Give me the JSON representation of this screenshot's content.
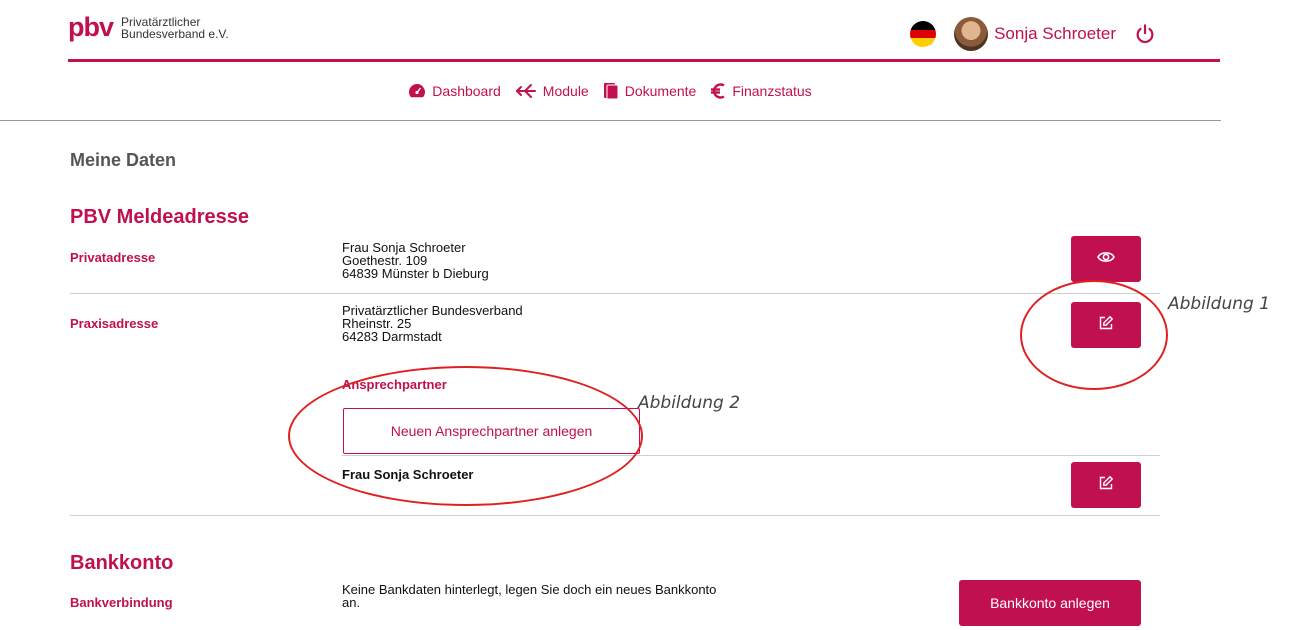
{
  "header": {
    "logo_mark": "pbv",
    "logo_line1": "Privatärztlicher",
    "logo_line2": "Bundesverband e.V.",
    "user_name": "Sonja Schroeter",
    "flag_colors": [
      "#000000",
      "#dd0000",
      "#ffce00"
    ],
    "icons": [
      "flag-de-icon",
      "avatar",
      "power-icon"
    ]
  },
  "nav": {
    "items": [
      {
        "label": "Dashboard",
        "icon": "dashboard-icon"
      },
      {
        "label": "Module",
        "icon": "module-icon"
      },
      {
        "label": "Dokumente",
        "icon": "documents-icon"
      },
      {
        "label": "Finanzstatus",
        "icon": "euro-icon"
      }
    ]
  },
  "main": {
    "title": "Meine Daten",
    "meldeadresse": {
      "title": "PBV Meldeadresse",
      "privat": {
        "label": "Privatadresse",
        "lines": [
          "Frau Sonja Schroeter",
          "Goethestr. 109",
          "64839 Münster b Dieburg"
        ]
      },
      "praxis": {
        "label": "Praxisadresse",
        "lines": [
          "Privatärztlicher Bundesverband",
          "Rheinstr. 25",
          "64283 Darmstadt"
        ]
      },
      "contacts": {
        "heading": "Ansprechpartner",
        "new_button": "Neuen Ansprechpartner anlegen",
        "contact_name": "Frau Sonja Schroeter"
      }
    },
    "bank": {
      "title": "Bankkonto",
      "label": "Bankverbindung",
      "text": "Keine Bankdaten hinterlegt, legen Sie doch ein neues Bankkonto an.",
      "button": "Bankkonto anlegen"
    }
  },
  "annotations": {
    "fig1": "Abbildung 1",
    "fig2": "Abbildung 2"
  },
  "colors": {
    "brand": "#c0104f",
    "annotation": "#e02020"
  }
}
